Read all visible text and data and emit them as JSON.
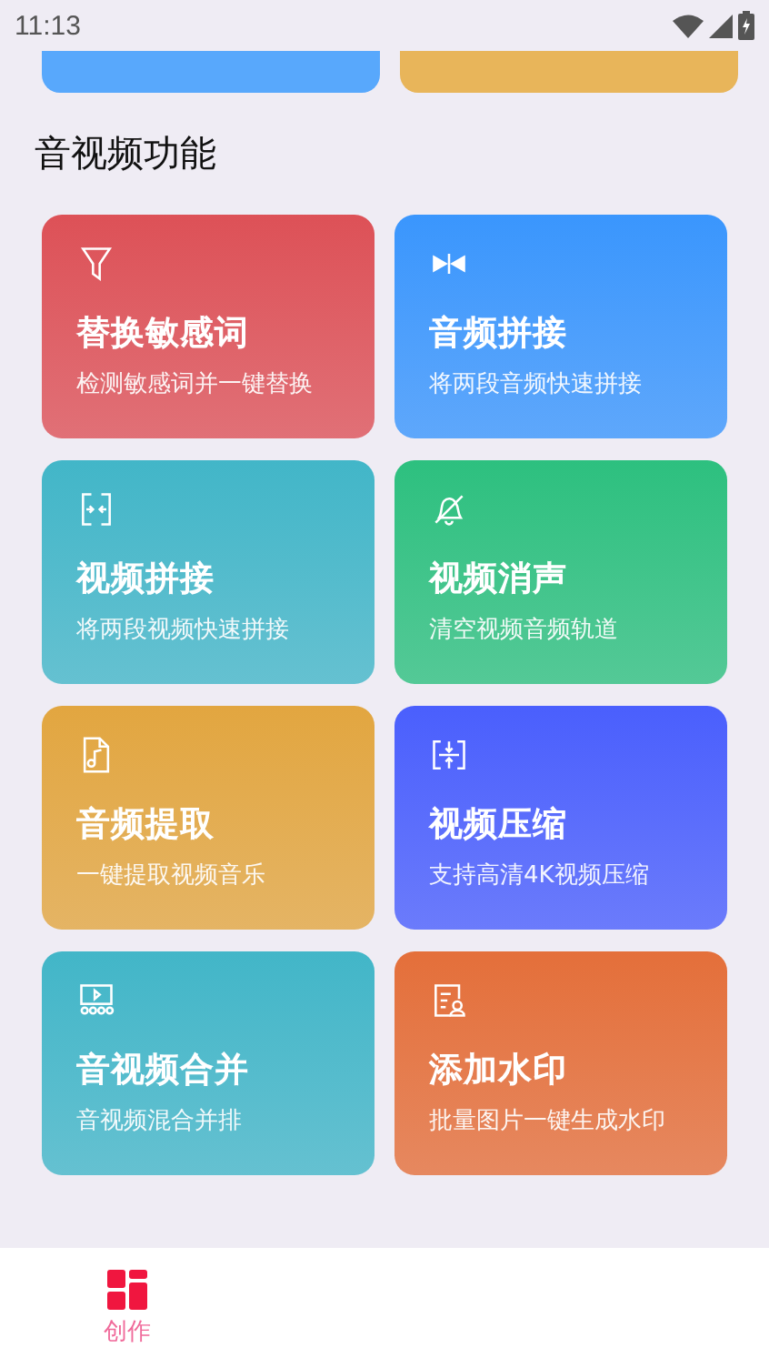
{
  "status_bar": {
    "time": "11:13"
  },
  "cut_cards": [
    {
      "color": "#58a8fc"
    },
    {
      "color": "#e8b55a"
    }
  ],
  "section": {
    "title": "音视频功能"
  },
  "features": [
    {
      "title": "替换敏感词",
      "subtitle": "检测敏感词并一键替换",
      "color": "#dd5157"
    },
    {
      "title": "音频拼接",
      "subtitle": "将两段音频快速拼接",
      "color": "#3a96fd"
    },
    {
      "title": "视频拼接",
      "subtitle": "将两段视频快速拼接",
      "color": "#42b6c8"
    },
    {
      "title": "视频消声",
      "subtitle": "清空视频音频轨道",
      "color": "#2dc07f"
    },
    {
      "title": "音频提取",
      "subtitle": "一键提取视频音乐",
      "color": "#e2a640"
    },
    {
      "title": "视频压缩",
      "subtitle": "支持高清4K视频压缩",
      "color": "#4a5ffd"
    },
    {
      "title": "音视频合并",
      "subtitle": "音视频混合并排",
      "color": "#42b6c8"
    },
    {
      "title": "添加水印",
      "subtitle": "批量图片一键生成水印",
      "color": "#e46f3a"
    }
  ],
  "nav": [
    {
      "label": "创作",
      "selected": true
    }
  ]
}
